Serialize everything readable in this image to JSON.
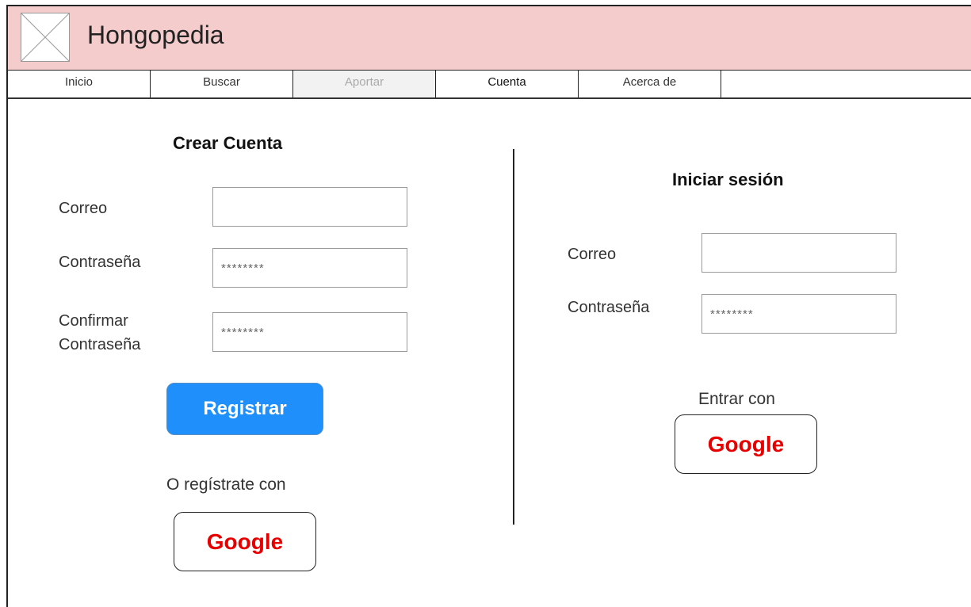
{
  "app": {
    "title": "Hongopedia",
    "logo_icon": "image-placeholder-icon"
  },
  "nav": {
    "tabs": [
      {
        "label": "Inicio",
        "state": "normal"
      },
      {
        "label": "Buscar",
        "state": "normal"
      },
      {
        "label": "Aportar",
        "state": "disabled"
      },
      {
        "label": "Cuenta",
        "state": "active"
      },
      {
        "label": "Acerca de",
        "state": "normal"
      }
    ]
  },
  "register": {
    "heading": "Crear Cuenta",
    "email_label": "Correo",
    "email_value": "",
    "password_label": "Contraseña",
    "password_value": "********",
    "confirm_label_line1": "Confirmar",
    "confirm_label_line2": "Contraseña",
    "confirm_value": "********",
    "submit_label": "Registrar",
    "alt_caption": "O regístrate con",
    "google_label": "Google"
  },
  "login": {
    "heading": "Iniciar sesión",
    "email_label": "Correo",
    "email_value": "",
    "password_label": "Contraseña",
    "password_value": "********",
    "alt_caption": "Entrar con",
    "google_label": "Google"
  },
  "colors": {
    "titlebar_bg": "#f5cccc",
    "primary_button": "#1e8ffb",
    "google_text": "#e60000"
  }
}
